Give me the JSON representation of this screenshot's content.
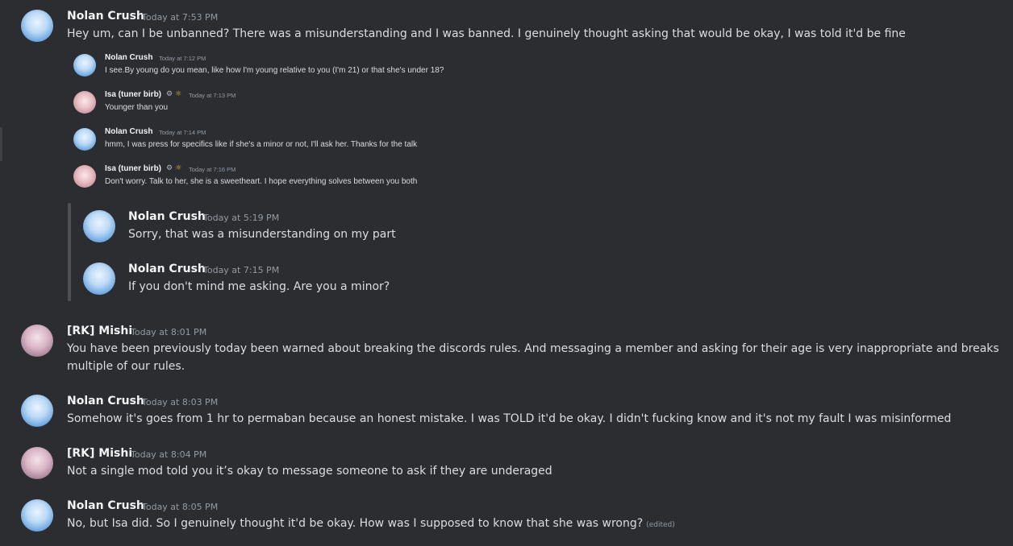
{
  "messages": [
    {
      "author": "Nolan Crush",
      "timestamp": "Today at 7:53 PM",
      "text": "Hey um, can I be unbanned? There was a misunderstanding and I was banned. I genuinely thought asking that would be okay, I was told it'd be fine"
    },
    {
      "author": "[RK] Mishi",
      "timestamp": "Today at 8:01 PM",
      "text_line1": "You have been previously today been warned about breaking the discords rules. And messaging a member and asking for their age is very inappropriate and breaks",
      "text_line2": "multiple of our rules."
    },
    {
      "author": "Nolan Crush",
      "timestamp": "Today at 8:03 PM",
      "text": "Somehow it's goes from 1 hr to permaban because an honest mistake. I was TOLD it'd be okay. I didn't fucking know and it's not my fault I was misinformed"
    },
    {
      "author": "[RK] Mishi",
      "timestamp": "Today at 8:04 PM",
      "text": "Not a single mod told you it’s okay to message someone to ask if they are underaged"
    },
    {
      "author": "Nolan Crush",
      "timestamp": "Today at 8:05 PM",
      "text": "No, but Isa did. So I genuinely thought it'd be okay. How was I supposed to know that she was wrong?",
      "edited": "(edited)"
    }
  ],
  "screenshot_messages": [
    {
      "author": "Nolan Crush",
      "timestamp": "Today at 7:12 PM",
      "text": "I see.By young do you mean, like how I'm young relative to you (I'm 21) or that she's under 18?"
    },
    {
      "author": "Isa (tuner birb)",
      "timestamp": "Today at 7:13 PM",
      "text": "Younger than you"
    },
    {
      "author": "Nolan Crush",
      "timestamp": "Today at 7:14 PM",
      "text": "hmm, I was press for specifics like if she's a minor or not, I'll ask her. Thanks for the talk"
    },
    {
      "author": "Isa (tuner birb)",
      "timestamp": "Today at 7:16 PM",
      "text": "Don't worry. Talk to her, she is a sweetheart. I hope everything solves between you both"
    }
  ],
  "quoted_messages": [
    {
      "author": "Nolan Crush",
      "timestamp": "Today at 5:19 PM",
      "text": "Sorry, that was a misunderstanding on my part"
    },
    {
      "author": "Nolan Crush",
      "timestamp": "Today at 7:15 PM",
      "text": "If you don't mind me asking. Are you a minor?"
    }
  ],
  "badges": {
    "gear": "⚙",
    "sun": "☼"
  },
  "colors": {
    "background": "#2b2d31",
    "author": "#f2f3f5",
    "text": "#dbdee1",
    "timestamp": "#949ba4"
  }
}
